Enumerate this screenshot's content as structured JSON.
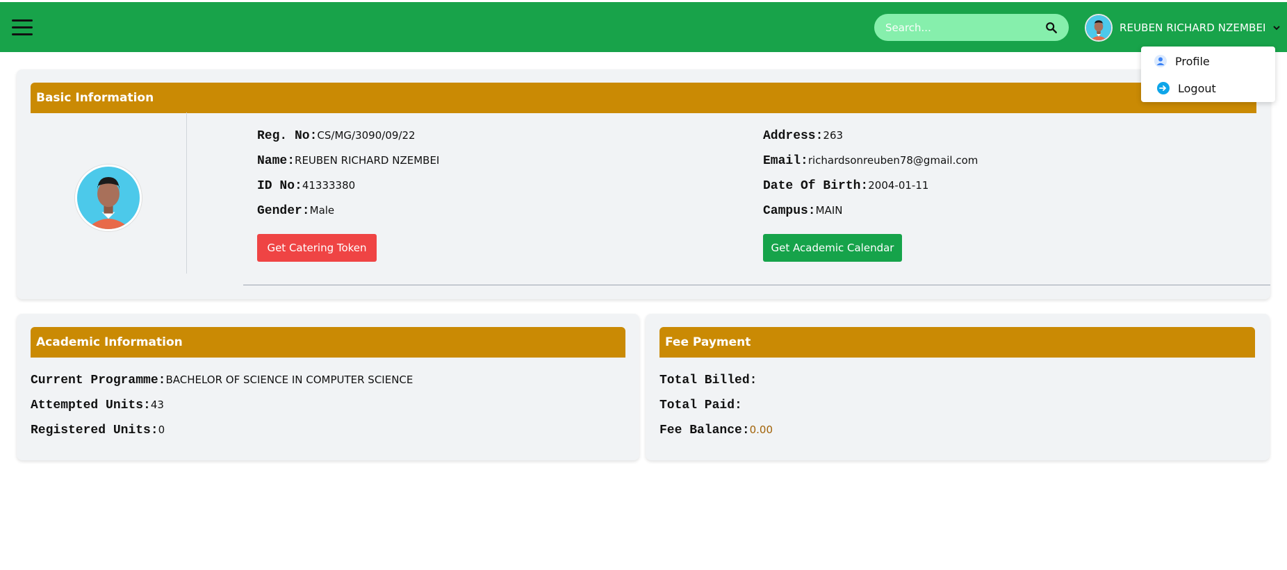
{
  "topbar": {
    "search_placeholder": "Search...",
    "user_name": "REUBEN RICHARD NZEMBEI",
    "dropdown": [
      {
        "label": "Profile",
        "icon": "user-icon"
      },
      {
        "label": "Logout",
        "icon": "logout-icon"
      }
    ]
  },
  "basic": {
    "title": "Basic Information",
    "reg_label": "Reg. No:",
    "reg_value": "CS/MG/3090/09/22",
    "name_label": "Name:",
    "name_value": "REUBEN RICHARD NZEMBEI",
    "id_label": "ID No:",
    "id_value": "41333380",
    "gender_label": "Gender:",
    "gender_value": "Male",
    "address_label": "Address:",
    "address_value": "263",
    "email_label": "Email:",
    "email_value": "richardsonreuben78@gmail.com",
    "dob_label": "Date Of Birth:",
    "dob_value": "2004-01-11",
    "campus_label": "Campus:",
    "campus_value": "MAIN",
    "catering_button": "Get Catering Token",
    "calendar_button": "Get Academic Calendar"
  },
  "academic": {
    "title": "Academic Information",
    "programme_label": "Current Programme:",
    "programme_value": "BACHELOR OF SCIENCE IN COMPUTER SCIENCE",
    "attempted_label": "Attempted Units:",
    "attempted_value": "43",
    "registered_label": "Registered Units:",
    "registered_value": "0"
  },
  "fee": {
    "title": "Fee Payment",
    "billed_label": "Total Billed:",
    "billed_value": "",
    "paid_label": "Total Paid:",
    "paid_value": "",
    "balance_label": "Fee Balance:",
    "balance_value": "0.00"
  },
  "colors": {
    "topbar": "#18a34a",
    "card_header": "#ca8a04",
    "danger_button": "#ef4444",
    "success_button": "#16a34a"
  }
}
